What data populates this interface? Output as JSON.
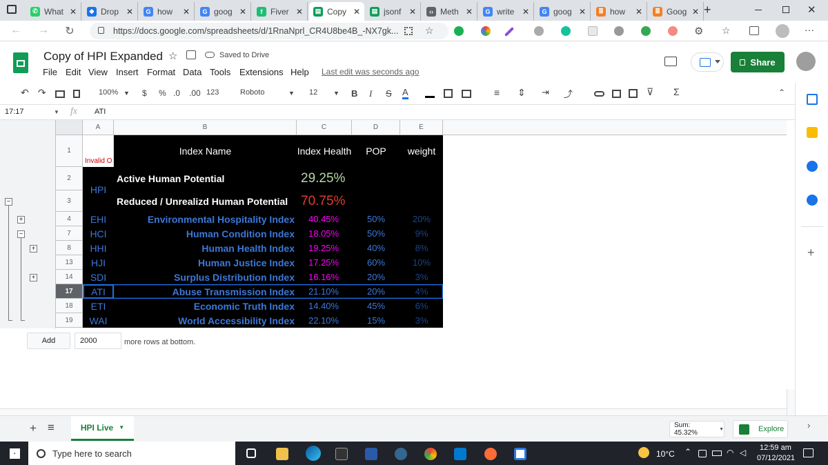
{
  "browser": {
    "tabs": [
      {
        "label": "What",
        "color": "#25d366",
        "icon": "whatsapp-icon"
      },
      {
        "label": "Drop",
        "color": "#1a73e8",
        "icon": "dropbox-icon"
      },
      {
        "label": "how",
        "color": "#4285f4",
        "icon": "google-icon"
      },
      {
        "label": "goog",
        "color": "#4285f4",
        "icon": "google-icon"
      },
      {
        "label": "Fiver",
        "color": "#1dbf73",
        "icon": "fiverr-icon"
      },
      {
        "label": "Copy",
        "color": "#0f9d58",
        "icon": "sheets-icon"
      },
      {
        "label": "jsonf",
        "color": "#0f9d58",
        "icon": "sheets-icon"
      },
      {
        "label": "Meth",
        "color": "#5f6368",
        "icon": "code-icon"
      },
      {
        "label": "write",
        "color": "#4285f4",
        "icon": "google-icon"
      },
      {
        "label": "goog",
        "color": "#4285f4",
        "icon": "google-icon"
      },
      {
        "label": "how",
        "color": "#f48024",
        "icon": "stackoverflow-icon"
      },
      {
        "label": "Goog",
        "color": "#f48024",
        "icon": "stackoverflow-icon"
      }
    ],
    "new_tab": "+",
    "url": "https://docs.google.com/spreadsheets/d/1RnaNprl_CR4U8be4B_-NX7gk..."
  },
  "app": {
    "title": "Copy of HPI Expanded",
    "saved": "Saved to Drive",
    "menu": [
      "File",
      "Edit",
      "View",
      "Insert",
      "Format",
      "Data",
      "Tools",
      "Extensions",
      "Help"
    ],
    "last_edit": "Last edit was seconds ago",
    "share": "Share"
  },
  "toolbar": {
    "zoom": "100%",
    "currency": "$",
    "percent": "%",
    "dec_less": ".0",
    "dec_more": ".00",
    "format": "123",
    "font": "Roboto",
    "font_size": "12",
    "bold": "B",
    "italic": "I",
    "strike": "S",
    "text_color": "A"
  },
  "formula": {
    "namebox": "17:17",
    "fx": "fx",
    "value": "ATI"
  },
  "sheet": {
    "columns": [
      "A",
      "B",
      "C",
      "D",
      "E"
    ],
    "header": {
      "row": "1",
      "a": "Invalid O",
      "b": "Index Name",
      "c": "Index Health",
      "d": "POP",
      "e": "weight"
    },
    "hpi": {
      "code": "HPI",
      "rows": [
        {
          "row": "2",
          "name": "Active Human Potential",
          "value": "29.25%",
          "color": "#b6d7a8"
        },
        {
          "row": "3",
          "name": "Reduced / Unrealizd Human Potential",
          "value": "70.75%",
          "color": "#e03c31"
        }
      ]
    },
    "data_rows": [
      {
        "row": "4",
        "code": "EHI",
        "name": "Environmental Hospitality Index",
        "health": "40.45%",
        "pop": "50%",
        "weight": "20%",
        "hc": "#ff00ff"
      },
      {
        "row": "7",
        "code": "HCI",
        "name": "Human Condition Index",
        "health": "18.05%",
        "pop": "50%",
        "weight": "9%",
        "hc": "#ff00ff"
      },
      {
        "row": "8",
        "code": "HHI",
        "name": "Human Health Index",
        "health": "19.25%",
        "pop": "40%",
        "weight": "8%",
        "hc": "#ff00ff"
      },
      {
        "row": "13",
        "code": "HJI",
        "name": "Human Justice Index",
        "health": "17.25%",
        "pop": "60%",
        "weight": "10%",
        "hc": "#ff00ff"
      },
      {
        "row": "14",
        "code": "SDI",
        "name": "Surplus Distribution Index",
        "health": "16.16%",
        "pop": "20%",
        "weight": "3%",
        "hc": "#ff00ff"
      },
      {
        "row": "17",
        "code": "ATI",
        "name": "Abuse Transmission Index",
        "health": "21.10%",
        "pop": "20%",
        "weight": "4%",
        "hc": "#3c78d8"
      },
      {
        "row": "18",
        "code": "ETI",
        "name": "Economic Truth Index",
        "health": "14.40%",
        "pop": "45%",
        "weight": "6%",
        "hc": "#3c78d8"
      },
      {
        "row": "19",
        "code": "WAI",
        "name": "World Accessibility Index",
        "health": "22.10%",
        "pop": "15%",
        "weight": "3%",
        "hc": "#3c78d8"
      }
    ],
    "selected_row": "17",
    "add": {
      "button": "Add",
      "count": "2000",
      "suffix": "more rows at bottom."
    }
  },
  "bottom": {
    "add_sheet": "+",
    "all_sheets": "≡",
    "sheet_tab": "HPI Live",
    "sum": "Sum: 45.32%",
    "explore": "Explore"
  },
  "taskbar": {
    "search": "Type here to search",
    "temp": "10°C",
    "time": "12:59 am",
    "date": "07/12/2021"
  }
}
